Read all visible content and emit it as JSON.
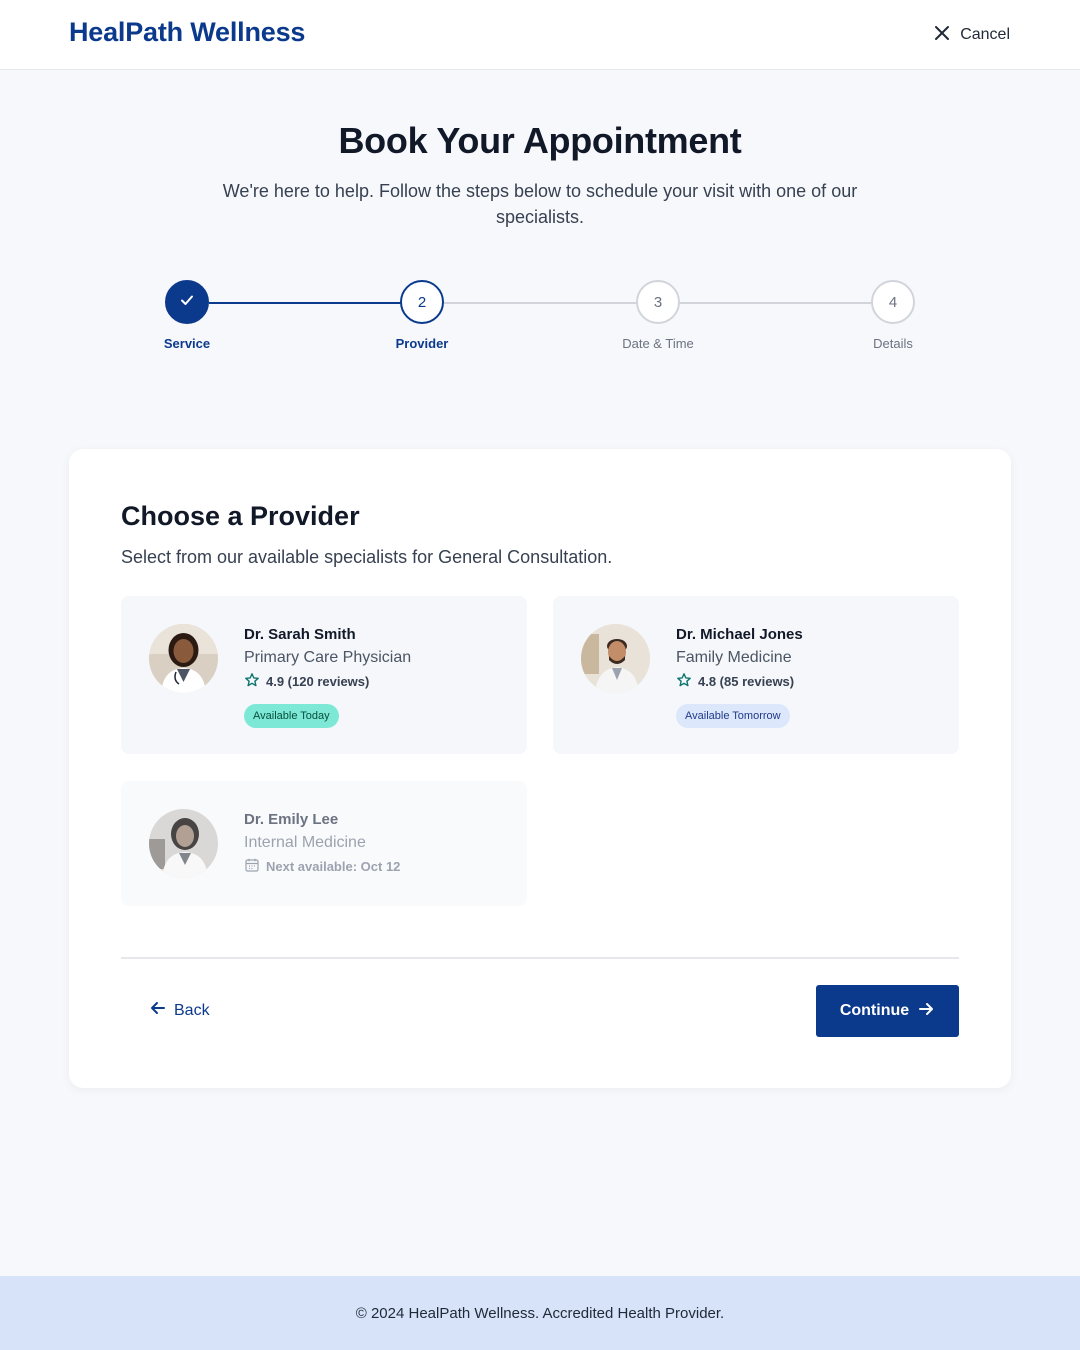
{
  "header": {
    "brand": "HealPath Wellness",
    "cancel_label": "Cancel"
  },
  "hero": {
    "title": "Book Your Appointment",
    "subtitle": "We're here to help. Follow the steps below to schedule your visit with one of our specialists."
  },
  "stepper": {
    "current_step": 2,
    "steps": [
      {
        "number": "1",
        "label": "Service",
        "state": "complete"
      },
      {
        "number": "2",
        "label": "Provider",
        "state": "active"
      },
      {
        "number": "3",
        "label": "Date & Time",
        "state": "upcoming"
      },
      {
        "number": "4",
        "label": "Details",
        "state": "upcoming"
      }
    ]
  },
  "main": {
    "title": "Choose a Provider",
    "subtitle": "Select from our available specialists for General Consultation.",
    "providers": [
      {
        "name": "Dr. Sarah Smith",
        "role": "Primary Care Physician",
        "rating": "4.9 (120 reviews)",
        "availability": "Available Today",
        "status": "available"
      },
      {
        "name": "Dr. Michael Jones",
        "role": "Family Medicine",
        "rating": "4.8 (85 reviews)",
        "availability": "Available Tomorrow",
        "status": "available"
      },
      {
        "name": "Dr. Emily Lee",
        "role": "Internal Medicine",
        "next_available": "Next available: Oct 12",
        "status": "unavailable"
      }
    ],
    "back_label": "Back",
    "continue_label": "Continue"
  },
  "footer": {
    "text": "© 2024 HealPath Wellness. Accredited Health Provider."
  },
  "colors": {
    "primary": "#0b3a8c",
    "badge_today": "#7ee8d6",
    "badge_tomorrow": "#dce7fb",
    "footer_bg": "#d6e3f9"
  },
  "icons": {
    "cancel": "close-icon",
    "step_complete": "check-icon",
    "rating": "star-icon",
    "next_available": "calendar-icon",
    "back": "arrow-left-icon",
    "continue": "arrow-right-icon"
  }
}
